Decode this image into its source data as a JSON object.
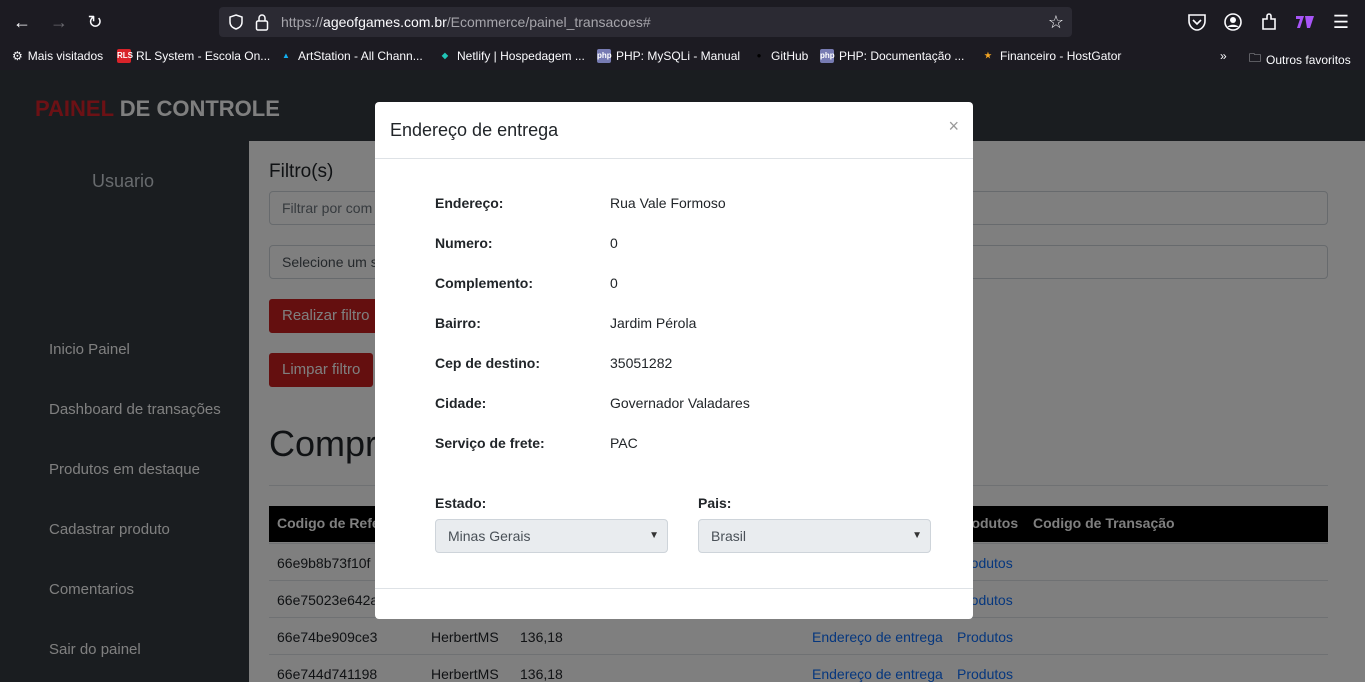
{
  "browser": {
    "url_prefix": "https://",
    "url_host": "ageofgames.com.br",
    "url_path": "/Ecommerce/painel_transacoes#",
    "bookmarks": [
      "Mais visitados",
      "RL System - Escola On...",
      "ArtStation - All Chann...",
      "Netlify | Hospedagem ...",
      "PHP: MySQLi - Manual",
      "GitHub",
      "PHP: Documentação ...",
      "Financeiro - HostGator"
    ],
    "other_bookmarks": "Outros favoritos"
  },
  "header": {
    "brand_red": "PAINEL",
    "brand_white": " DE CONTROLE"
  },
  "sidebar": {
    "user": "Usuario",
    "items": [
      "Inicio Painel",
      "Dashboard de transações",
      "Produtos em destaque",
      "Cadastrar produto",
      "Comentarios",
      "Sair do painel"
    ]
  },
  "main": {
    "filter_title": "Filtro(s)",
    "filter_placeholder": "Filtrar por com",
    "filter_select": "Selecione um s",
    "btn_filter": "Realizar filtro",
    "btn_clear": "Limpar filtro",
    "section_title": "Compr",
    "table_headers": [
      "Codigo de Refe",
      "rodutos",
      "Codigo de Transação"
    ],
    "rows": [
      {
        "ref": "66e9b8b73f10f",
        "user": "",
        "value": "",
        "addr": "",
        "prod": "rodutos"
      },
      {
        "ref": "66e75023e642a",
        "user": "",
        "value": "",
        "addr": "",
        "prod": "rodutos"
      },
      {
        "ref": "66e74be909ce3",
        "user": "HerbertMS",
        "value": "136,18",
        "addr": "Endereço de entrega",
        "prod": "Produtos"
      },
      {
        "ref": "66e744d741198",
        "user": "HerbertMS",
        "value": "136,18",
        "addr": "Endereço de entrega",
        "prod": "Produtos"
      }
    ]
  },
  "modal": {
    "title": "Endereço de entrega",
    "close": "×",
    "fields": [
      {
        "label": "Endereço:",
        "value": "Rua Vale Formoso"
      },
      {
        "label": "Numero:",
        "value": "0"
      },
      {
        "label": "Complemento:",
        "value": "0"
      },
      {
        "label": "Bairro:",
        "value": "Jardim Pérola"
      },
      {
        "label": "Cep de destino:",
        "value": "35051282"
      },
      {
        "label": "Cidade:",
        "value": "Governador Valadares"
      },
      {
        "label": "Serviço de frete:",
        "value": "PAC"
      }
    ],
    "estado_label": "Estado:",
    "estado_value": "Minas Gerais",
    "pais_label": "Pais:",
    "pais_value": "Brasil"
  }
}
